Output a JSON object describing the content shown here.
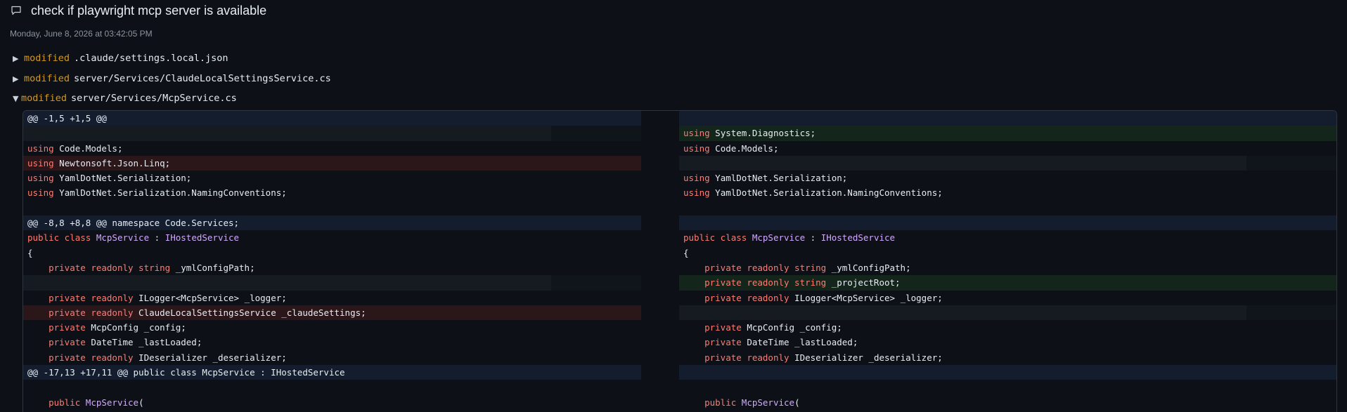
{
  "header": {
    "title": "check if playwright mcp server is available",
    "timestamp": "Monday, June 8, 2026 at 03:42:05 PM"
  },
  "files": [
    {
      "status": "modified",
      "path": ".claude/settings.local.json",
      "expanded": false
    },
    {
      "status": "modified",
      "path": "server/Services/ClaudeLocalSettingsService.cs",
      "expanded": false
    },
    {
      "status": "modified",
      "path": "server/Services/McpService.cs",
      "expanded": true
    }
  ],
  "diff": {
    "left": [
      {
        "type": "hunk",
        "tokens": [
          {
            "c": "n",
            "t": "@@ -1,5 +1,5 @@"
          }
        ]
      },
      {
        "type": "filler",
        "tokens": []
      },
      {
        "type": "ctx",
        "tokens": [
          {
            "c": "k",
            "t": "using"
          },
          {
            "c": "n",
            "t": " Code.Models;"
          }
        ]
      },
      {
        "type": "del",
        "tokens": [
          {
            "c": "k",
            "t": "using"
          },
          {
            "c": "n",
            "t": " Newtonsoft.Json.Linq;"
          }
        ]
      },
      {
        "type": "ctx",
        "tokens": [
          {
            "c": "k",
            "t": "using"
          },
          {
            "c": "n",
            "t": " YamlDotNet.Serialization;"
          }
        ]
      },
      {
        "type": "ctx",
        "tokens": [
          {
            "c": "k",
            "t": "using"
          },
          {
            "c": "n",
            "t": " YamlDotNet.Serialization.NamingConventions;"
          }
        ]
      },
      {
        "type": "ctx",
        "tokens": []
      },
      {
        "type": "hunk",
        "tokens": [
          {
            "c": "n",
            "t": "@@ -8,8 +8,8 @@ namespace Code.Services;"
          }
        ]
      },
      {
        "type": "ctx",
        "tokens": [
          {
            "c": "k",
            "t": "public class"
          },
          {
            "c": "n",
            "t": " "
          },
          {
            "c": "t",
            "t": "McpService"
          },
          {
            "c": "n",
            "t": " : "
          },
          {
            "c": "t",
            "t": "IHostedService"
          }
        ]
      },
      {
        "type": "ctx",
        "tokens": [
          {
            "c": "n",
            "t": "{"
          }
        ]
      },
      {
        "type": "ctx",
        "tokens": [
          {
            "c": "n",
            "t": "    "
          },
          {
            "c": "k",
            "t": "private readonly string"
          },
          {
            "c": "n",
            "t": " _ymlConfigPath;"
          }
        ]
      },
      {
        "type": "filler",
        "tokens": []
      },
      {
        "type": "ctx",
        "tokens": [
          {
            "c": "n",
            "t": "    "
          },
          {
            "c": "k",
            "t": "private readonly"
          },
          {
            "c": "n",
            "t": " ILogger<McpService> _logger;"
          }
        ]
      },
      {
        "type": "del",
        "tokens": [
          {
            "c": "n",
            "t": "    "
          },
          {
            "c": "k",
            "t": "private readonly"
          },
          {
            "c": "n",
            "t": " ClaudeLocalSettingsService _claudeSettings;"
          }
        ]
      },
      {
        "type": "ctx",
        "tokens": [
          {
            "c": "n",
            "t": "    "
          },
          {
            "c": "k",
            "t": "private"
          },
          {
            "c": "n",
            "t": " McpConfig _config;"
          }
        ]
      },
      {
        "type": "ctx",
        "tokens": [
          {
            "c": "n",
            "t": "    "
          },
          {
            "c": "k",
            "t": "private"
          },
          {
            "c": "n",
            "t": " DateTime _lastLoaded;"
          }
        ]
      },
      {
        "type": "ctx",
        "tokens": [
          {
            "c": "n",
            "t": "    "
          },
          {
            "c": "k",
            "t": "private readonly"
          },
          {
            "c": "n",
            "t": " IDeserializer _deserializer;"
          }
        ]
      },
      {
        "type": "hunk",
        "tokens": [
          {
            "c": "n",
            "t": "@@ -17,13 +17,11 @@ public class McpService : IHostedService"
          }
        ]
      },
      {
        "type": "ctx",
        "tokens": []
      },
      {
        "type": "ctx",
        "tokens": [
          {
            "c": "n",
            "t": "    "
          },
          {
            "c": "k",
            "t": "public"
          },
          {
            "c": "n",
            "t": " "
          },
          {
            "c": "t",
            "t": "McpService"
          },
          {
            "c": "n",
            "t": "("
          }
        ]
      }
    ],
    "right": [
      {
        "type": "hunk",
        "tokens": []
      },
      {
        "type": "add",
        "tokens": [
          {
            "c": "k",
            "t": "using"
          },
          {
            "c": "n",
            "t": " System.Diagnostics;"
          }
        ]
      },
      {
        "type": "ctx",
        "tokens": [
          {
            "c": "k",
            "t": "using"
          },
          {
            "c": "n",
            "t": " Code.Models;"
          }
        ]
      },
      {
        "type": "filler",
        "tokens": []
      },
      {
        "type": "ctx",
        "tokens": [
          {
            "c": "k",
            "t": "using"
          },
          {
            "c": "n",
            "t": " YamlDotNet.Serialization;"
          }
        ]
      },
      {
        "type": "ctx",
        "tokens": [
          {
            "c": "k",
            "t": "using"
          },
          {
            "c": "n",
            "t": " YamlDotNet.Serialization.NamingConventions;"
          }
        ]
      },
      {
        "type": "ctx",
        "tokens": []
      },
      {
        "type": "hunk",
        "tokens": []
      },
      {
        "type": "ctx",
        "tokens": [
          {
            "c": "k",
            "t": "public class"
          },
          {
            "c": "n",
            "t": " "
          },
          {
            "c": "t",
            "t": "McpService"
          },
          {
            "c": "n",
            "t": " : "
          },
          {
            "c": "t",
            "t": "IHostedService"
          }
        ]
      },
      {
        "type": "ctx",
        "tokens": [
          {
            "c": "n",
            "t": "{"
          }
        ]
      },
      {
        "type": "ctx",
        "tokens": [
          {
            "c": "n",
            "t": "    "
          },
          {
            "c": "k",
            "t": "private readonly string"
          },
          {
            "c": "n",
            "t": " _ymlConfigPath;"
          }
        ]
      },
      {
        "type": "add",
        "tokens": [
          {
            "c": "n",
            "t": "    "
          },
          {
            "c": "k",
            "t": "private readonly string"
          },
          {
            "c": "n",
            "t": " _projectRoot;"
          }
        ]
      },
      {
        "type": "ctx",
        "tokens": [
          {
            "c": "n",
            "t": "    "
          },
          {
            "c": "k",
            "t": "private readonly"
          },
          {
            "c": "n",
            "t": " ILogger<McpService> _logger;"
          }
        ]
      },
      {
        "type": "filler",
        "tokens": []
      },
      {
        "type": "ctx",
        "tokens": [
          {
            "c": "n",
            "t": "    "
          },
          {
            "c": "k",
            "t": "private"
          },
          {
            "c": "n",
            "t": " McpConfig _config;"
          }
        ]
      },
      {
        "type": "ctx",
        "tokens": [
          {
            "c": "n",
            "t": "    "
          },
          {
            "c": "k",
            "t": "private"
          },
          {
            "c": "n",
            "t": " DateTime _lastLoaded;"
          }
        ]
      },
      {
        "type": "ctx",
        "tokens": [
          {
            "c": "n",
            "t": "    "
          },
          {
            "c": "k",
            "t": "private readonly"
          },
          {
            "c": "n",
            "t": " IDeserializer _deserializer;"
          }
        ]
      },
      {
        "type": "hunk",
        "tokens": []
      },
      {
        "type": "ctx",
        "tokens": []
      },
      {
        "type": "ctx",
        "tokens": [
          {
            "c": "n",
            "t": "    "
          },
          {
            "c": "k",
            "t": "public"
          },
          {
            "c": "n",
            "t": " "
          },
          {
            "c": "t",
            "t": "McpService"
          },
          {
            "c": "n",
            "t": "("
          }
        ]
      }
    ]
  }
}
